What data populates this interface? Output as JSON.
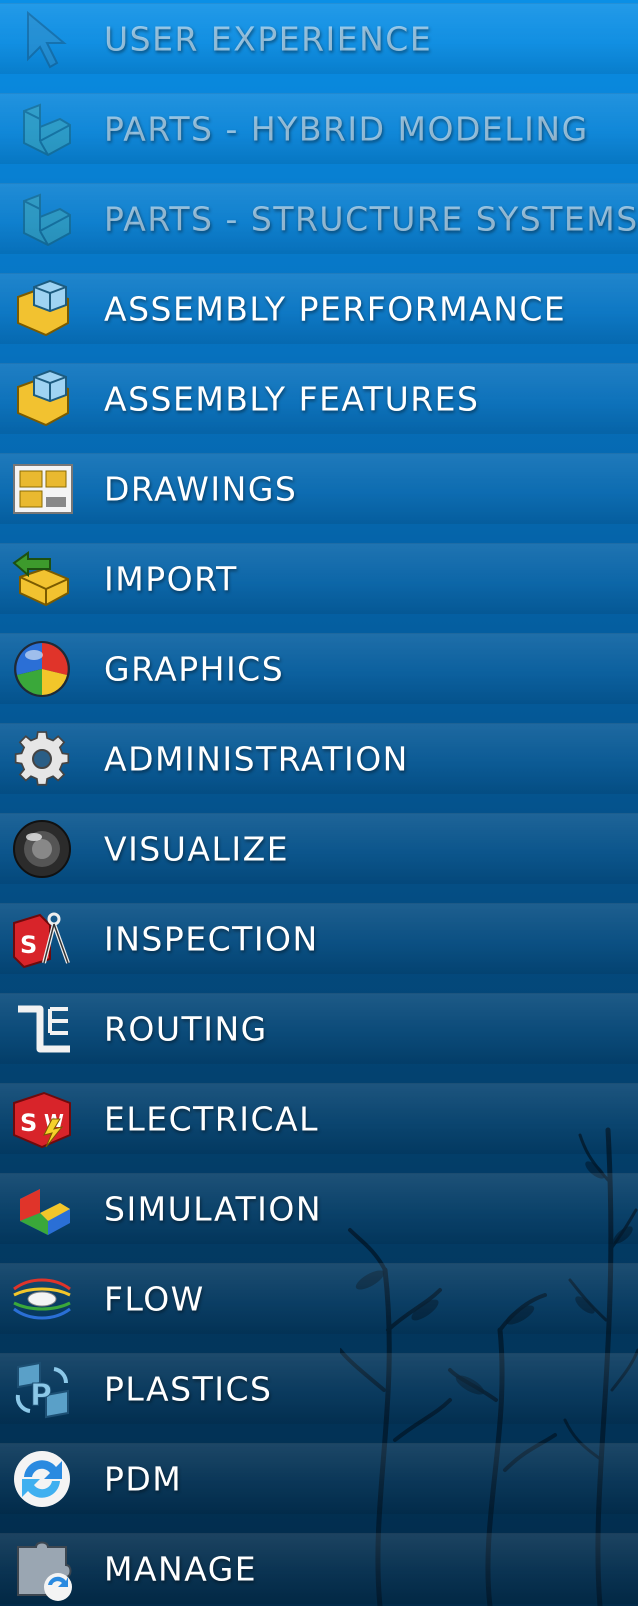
{
  "menu": {
    "items": [
      {
        "label": "USER EXPERIENCE",
        "icon": "cursor-arrow-icon",
        "dim": true
      },
      {
        "label": "PARTS - HYBRID MODELING",
        "icon": "part-block-icon",
        "dim": true
      },
      {
        "label": "PARTS - STRUCTURE SYSTEMS",
        "icon": "part-block-icon",
        "dim": true
      },
      {
        "label": "ASSEMBLY PERFORMANCE",
        "icon": "assembly-icon",
        "dim": false
      },
      {
        "label": "ASSEMBLY FEATURES",
        "icon": "assembly-icon",
        "dim": false
      },
      {
        "label": "DRAWINGS",
        "icon": "drawing-sheet-icon",
        "dim": false
      },
      {
        "label": "IMPORT",
        "icon": "import-icon",
        "dim": false
      },
      {
        "label": "GRAPHICS",
        "icon": "graphics-sphere-icon",
        "dim": false
      },
      {
        "label": "ADMINISTRATION",
        "icon": "gear-icon",
        "dim": false
      },
      {
        "label": "VISUALIZE",
        "icon": "visualize-sphere-icon",
        "dim": false
      },
      {
        "label": "INSPECTION",
        "icon": "inspection-caliper-icon",
        "dim": false
      },
      {
        "label": "ROUTING",
        "icon": "routing-pipe-icon",
        "dim": false
      },
      {
        "label": "ELECTRICAL",
        "icon": "electrical-sw-icon",
        "dim": false
      },
      {
        "label": "SIMULATION",
        "icon": "simulation-icon",
        "dim": false
      },
      {
        "label": "FLOW",
        "icon": "flow-icon",
        "dim": false
      },
      {
        "label": "PLASTICS",
        "icon": "plastics-icon",
        "dim": false
      },
      {
        "label": "PDM",
        "icon": "pdm-sync-icon",
        "dim": false
      },
      {
        "label": "MANAGE",
        "icon": "manage-puzzle-icon",
        "dim": false
      }
    ]
  },
  "colors": {
    "background_top": "#0a8fe6",
    "background_bottom": "#022b4a",
    "label": "#ffffff"
  }
}
